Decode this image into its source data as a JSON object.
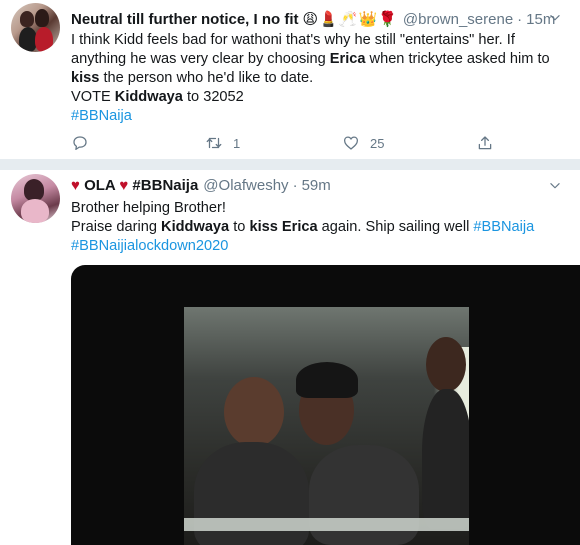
{
  "tweet1": {
    "name": "Neutral till further notice, I no fit",
    "emojis": "😩💄🥂👑🌹",
    "handle": "@brown_serene",
    "dot": "·",
    "time": "15m",
    "text": {
      "p1": "I think Kidd feels bad for wathoni that's why he still \"entertains\" her. If anything he was very clear by choosing ",
      "erica": "Erica",
      "p2": " when trickytee asked him to ",
      "kiss": "kiss",
      "p3": " the person who he'd like to date.",
      "vote_pre": "VOTE ",
      "kiddwaya": "Kiddwaya",
      "vote_post": " to 32052",
      "hashtag": "#BBNaija"
    },
    "actions": {
      "reply_count": "",
      "retweet_count": "1",
      "like_count": "25"
    }
  },
  "tweet2": {
    "heart1": "♥",
    "name_part1": " OLA ",
    "heart2": "♥",
    "name_part2": " #BBNaija",
    "handle": "@Olafweshy",
    "dot": "·",
    "time": "59m",
    "text": {
      "line1": "Brother helping Brother!",
      "p1": "Praise daring ",
      "kiddwaya": "Kiddwaya",
      "p2": " to ",
      "kiss": "kiss",
      "p3": " ",
      "erica": "Erica",
      "p4": " again. Ship sailing well ",
      "hashtag1": "#BBNaija",
      "hashtag2": "#BBNaijialockdown2020"
    }
  },
  "colors": {
    "text": "#14171a",
    "secondary": "#657786",
    "link": "#1b95e0",
    "heart": "#c0102a",
    "divider": "#e6ecf0"
  }
}
